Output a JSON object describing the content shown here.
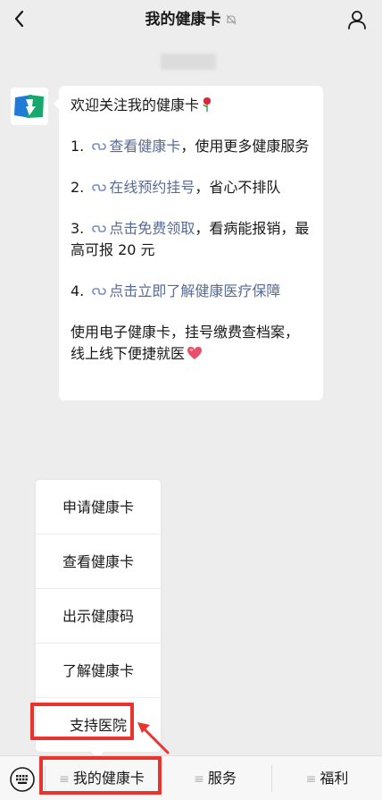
{
  "header": {
    "title": "我的健康卡",
    "back_icon": "chevron-left-icon",
    "mute_icon": "bell-muted-icon",
    "profile_icon": "person-icon"
  },
  "message": {
    "greeting": "欢迎关注我的健康卡",
    "items": [
      {
        "num": "1.",
        "link": "查看健康卡",
        "rest": "，使用更多健康服务"
      },
      {
        "num": "2.",
        "link": "在线预约挂号",
        "rest": "，省心不排队"
      },
      {
        "num": "3.",
        "link": "点击免费领取",
        "rest": "，看病能报销，最高可报 20 元"
      },
      {
        "num": "4.",
        "link": "点击立即了解健康医疗保障",
        "rest": ""
      }
    ],
    "footer": "使用电子健康卡，挂号缴费查档案，线上线下便捷就医"
  },
  "submenu": {
    "items": [
      "申请健康卡",
      "查看健康卡",
      "出示健康码",
      "了解健康卡",
      "支持医院"
    ]
  },
  "bottom_menu": {
    "lines_glyph": "≡",
    "tabs": [
      "我的健康卡",
      "服务",
      "福利"
    ]
  },
  "colors": {
    "link": "#576b95",
    "highlight": "#e8332f",
    "background": "#ededed"
  }
}
